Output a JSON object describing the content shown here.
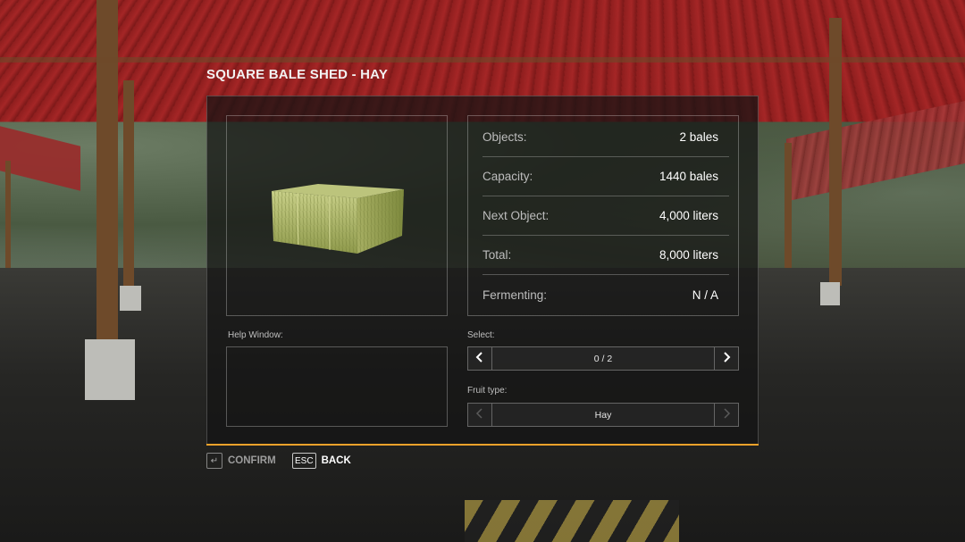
{
  "dialog": {
    "title": "SQUARE BALE SHED - HAY"
  },
  "info": {
    "rows": [
      {
        "label": "Objects:",
        "value": "2 bales"
      },
      {
        "label": "Capacity:",
        "value": "1440 bales"
      },
      {
        "label": "Next Object:",
        "value": "4,000 liters"
      },
      {
        "label": "Total:",
        "value": "8,000 liters"
      },
      {
        "label": "Fermenting:",
        "value": "N / A"
      }
    ]
  },
  "help": {
    "label": "Help Window:"
  },
  "select": {
    "label": "Select:",
    "value": "0 / 2",
    "prev_icon": "chevron-left-icon",
    "next_icon": "chevron-right-icon"
  },
  "fruit_type": {
    "label": "Fruit type:",
    "value": "Hay"
  },
  "hints": {
    "confirm_key": "↵",
    "confirm_label": "CONFIRM",
    "back_key": "ESC",
    "back_label": "BACK"
  },
  "colors": {
    "accent": "#f0a22a",
    "panel_bg": "rgba(20,20,20,0.72)",
    "text_primary": "#ffffff",
    "text_secondary": "#bdbdbd"
  }
}
